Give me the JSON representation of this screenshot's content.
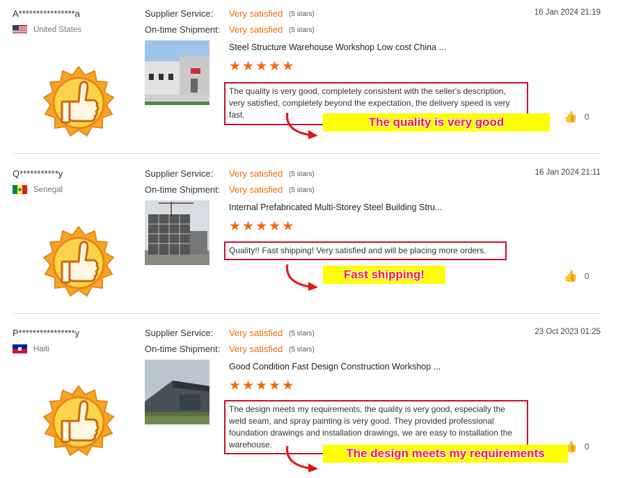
{
  "labels": {
    "supplier_service": "Supplier Service:",
    "ontime_shipment": "On-time Shipment:"
  },
  "colors": {
    "accent": "#f06a12",
    "highlight_border": "#c8102e",
    "callout_bg": "#ffff00",
    "callout_text": "#ff1a1a"
  },
  "reviews": [
    {
      "name": "A****************a",
      "country": "United States",
      "flag_icon": "us-flag-icon",
      "date": "16 Jan 2024 21:19",
      "supplier_service": "Very satisfied",
      "supplier_service_stars": "(5 stars)",
      "ontime_shipment": "Very satisfied",
      "ontime_shipment_stars": "(5 stars)",
      "product_title": "Steel Structure Warehouse Workshop Low cost China ...",
      "product_rating": 5,
      "comment": "The quality is very good, completely consistent with the seller's description, very satisfied,  completely beyond the expectation, the delivery speed is very fast.",
      "likes": "0",
      "callout": "The quality is very good"
    },
    {
      "name": "Q***********y",
      "country": "Senegal",
      "flag_icon": "senegal-flag-icon",
      "date": "16 Jan 2024 21:11",
      "supplier_service": "Very satisfied",
      "supplier_service_stars": "(5 stars)",
      "ontime_shipment": "Very satisfied",
      "ontime_shipment_stars": "(5 stars)",
      "product_title": "Internal Prefabricated Multi-Storey Steel Building Stru...",
      "product_rating": 5,
      "comment": "Quality!! Fast shipping! Very satisfied and will be placing more orders.",
      "likes": "0",
      "callout": "Fast shipping!"
    },
    {
      "name": "P****************y",
      "country": "Haiti",
      "flag_icon": "haiti-flag-icon",
      "date": "23 Oct 2023 01:25",
      "supplier_service": "Very satisfied",
      "supplier_service_stars": "(5 stars)",
      "ontime_shipment": "Very satisfied",
      "ontime_shipment_stars": "(5 stars)",
      "product_title": "Good Condition Fast Design Construction Workshop ...",
      "product_rating": 5,
      "comment": "The design meets my requirements, the quality is very good, especially the weld seam, and spray painting is very good. They provided professional foundation drawings and installation drawings, we are easy to installation the warehouse.",
      "likes": "0",
      "callout": "The design meets my requirements"
    }
  ]
}
